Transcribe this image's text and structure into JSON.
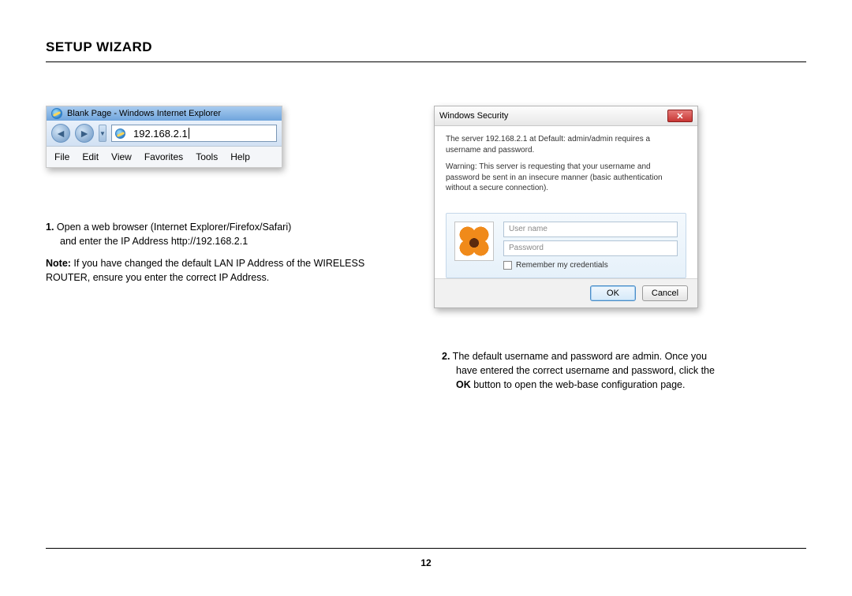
{
  "page": {
    "title": "SETUP WIZARD",
    "number": "12"
  },
  "browser_shot": {
    "window_title": "Blank Page - Windows Internet Explorer",
    "address": "192.168.2.1",
    "menu": {
      "file": "File",
      "edit": "Edit",
      "view": "View",
      "favorites": "Favorites",
      "tools": "Tools",
      "help": "Help"
    }
  },
  "security_dialog": {
    "title": "Windows Security",
    "msg1": "The server 192.168.2.1 at Default: admin/admin requires a username and password.",
    "msg2": "Warning: This server is requesting that your username and password be sent in an insecure manner (basic authentication without a secure connection).",
    "username_placeholder": "User name",
    "password_placeholder": "Password",
    "remember_label": "Remember my credentials",
    "ok_label": "OK",
    "cancel_label": "Cancel"
  },
  "step1": {
    "num": "1.",
    "line1": " Open a web browser (Internet Explorer/Firefox/Safari)",
    "line2": "and enter the IP Address http://192.168.2.1",
    "note_label": "Note:",
    "note_rest": " If you have changed the default LAN IP Address of the WIRELESS ROUTER, ensure you enter the correct IP Address."
  },
  "step2": {
    "num": "2.",
    "line1a": " The default username and password are admin. Once you",
    "line2": "have entered the correct username and password, click the ",
    "ok_word": "OK",
    "line2b": " button to open the web-base configuration page."
  }
}
